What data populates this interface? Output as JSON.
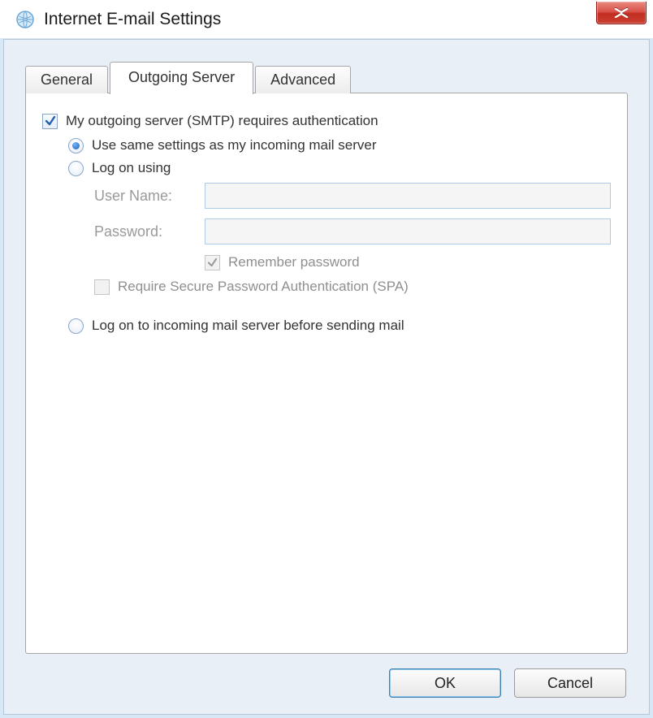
{
  "window": {
    "title": "Internet E-mail Settings"
  },
  "tabs": {
    "general": "General",
    "outgoing": "Outgoing Server",
    "advanced": "Advanced"
  },
  "form": {
    "requires_auth_label": "My outgoing server (SMTP) requires authentication",
    "requires_auth_checked": true,
    "use_same_label": "Use same settings as my incoming mail server",
    "logon_using_label": "Log on using",
    "username_label": "User Name:",
    "username_value": "",
    "password_label": "Password:",
    "password_value": "",
    "remember_label": "Remember password",
    "remember_checked": true,
    "spa_label": "Require Secure Password Authentication (SPA)",
    "spa_checked": false,
    "logon_incoming_label": "Log on to incoming mail server before sending mail",
    "selected_option": "use_same"
  },
  "buttons": {
    "ok": "OK",
    "cancel": "Cancel"
  }
}
